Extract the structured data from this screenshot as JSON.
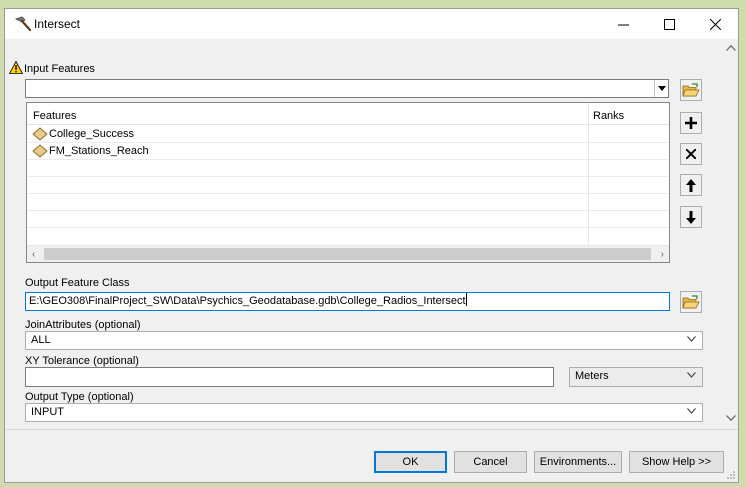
{
  "window": {
    "title": "Intersect",
    "minimize": "minimize",
    "maximize": "maximize",
    "close": "close"
  },
  "input_features": {
    "label": "Input Features",
    "value": ""
  },
  "features_table": {
    "headers": [
      "Features",
      "Ranks"
    ],
    "rows": [
      {
        "feature": "College_Success",
        "rank": ""
      },
      {
        "feature": "FM_Stations_Reach",
        "rank": ""
      }
    ],
    "empty_rows": 5
  },
  "output_feature_class": {
    "label": "Output Feature Class",
    "value": "E:\\GEO308\\FinalProject_SW\\Data\\Psychics_Geodatabase.gdb\\College_Radios_Intersect"
  },
  "join_attributes": {
    "label": "JoinAttributes (optional)",
    "value": "ALL"
  },
  "xy_tolerance": {
    "label": "XY Tolerance (optional)",
    "value": "",
    "unit": "Meters"
  },
  "output_type": {
    "label": "Output Type (optional)",
    "value": "INPUT"
  },
  "buttons": {
    "ok": "OK",
    "cancel": "Cancel",
    "environments": "Environments...",
    "show_help": "Show Help >>"
  },
  "colors": {
    "accent": "#0078d7",
    "layer_icon": "#e8c98a",
    "warning": "#ffd200"
  }
}
